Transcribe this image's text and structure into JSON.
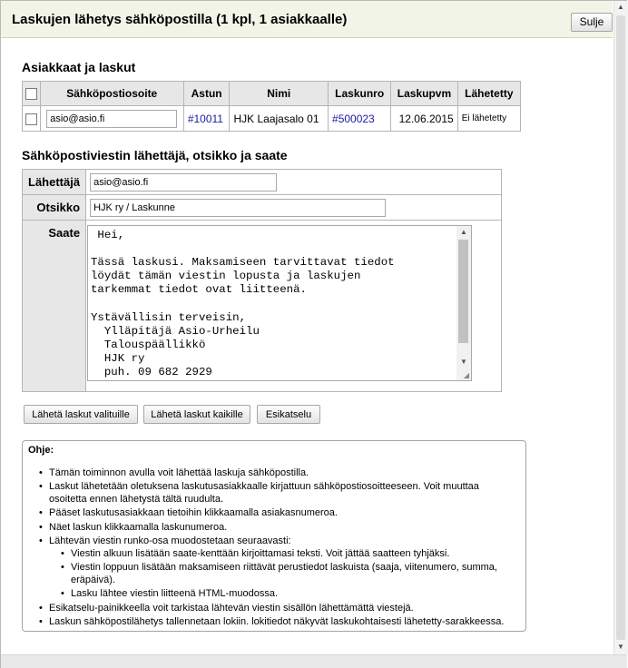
{
  "dialog": {
    "title": "Laskujen lähetys sähköpostilla (1 kpl, 1 asiakkaalle)",
    "close_label": "Sulje"
  },
  "customers_section": {
    "title": "Asiakkaat ja laskut",
    "columns": [
      "Sähköpostiosoite",
      "Astun",
      "Nimi",
      "Laskunro",
      "Laskupvm",
      "Lähetetty"
    ],
    "rows": [
      {
        "email": "asio@asio.fi",
        "customer_no": "#10011",
        "name": "HJK Laajasalo 01",
        "invoice_no": "#500023",
        "invoice_date": "12.06.2015",
        "sent": "Ei lähetetty"
      }
    ]
  },
  "message_section": {
    "title": "Sähköpostiviestin lähettäjä, otsikko ja saate",
    "sender_label": "Lähettäjä",
    "sender_value": "asio@asio.fi",
    "subject_label": "Otsikko",
    "subject_value": "HJK ry / Laskunne",
    "body_label": "Saate",
    "body_value": " Hei,\n\nTässä laskusi. Maksamiseen tarvittavat tiedot\nlöydät tämän viestin lopusta ja laskujen\ntarkemmat tiedot ovat liitteenä.\n\nYstävällisin terveisin,\n  Ylläpitäjä Asio-Urheilu\n  Talouspäällikkö\n  HJK ry\n  puh. 09 682 2929"
  },
  "actions": {
    "send_selected": "Lähetä laskut valituille",
    "send_all": "Lähetä laskut kaikille",
    "preview": "Esikatselu"
  },
  "help": {
    "title": "Ohje:",
    "items": [
      "Tämän toiminnon avulla voit lähettää laskuja sähköpostilla.",
      "Laskut lähetetään oletuksena laskutusasiakkaalle kirjattuun sähköpostiosoitteeseen. Voit muuttaa osoitetta ennen lähetystä tältä ruudulta.",
      "Pääset laskutusasiakkaan tietoihin klikkaamalla asiakasnumeroa.",
      "Näet laskun klikkaamalla laskunumeroa.",
      "Lähtevän viestin runko-osa muodostetaan seuraavasti:",
      "Esikatselu-painikkeella voit tarkistaa lähtevän viestin sisällön lähettämättä viestejä.",
      "Laskun sähköpostilähetys tallennetaan lokiin. lokitiedot näkyvät laskukohtaisesti lähetetty-sarakkeessa."
    ],
    "subitems": [
      "Viestin alkuun lisätään saate-kenttään kirjoittamasi teksti. Voit jättää saatteen tyhjäksi.",
      "Viestin loppuun lisätään maksamiseen riittävät perustiedot laskuista (saaja, viitenumero, summa, eräpäivä).",
      "Lasku lähtee viestin liitteenä HTML-muodossa."
    ]
  },
  "colors": {
    "title_bar_bg": "#f1f4e6",
    "header_cell_bg": "#e7e7e7",
    "link": "#1a1aa6"
  }
}
